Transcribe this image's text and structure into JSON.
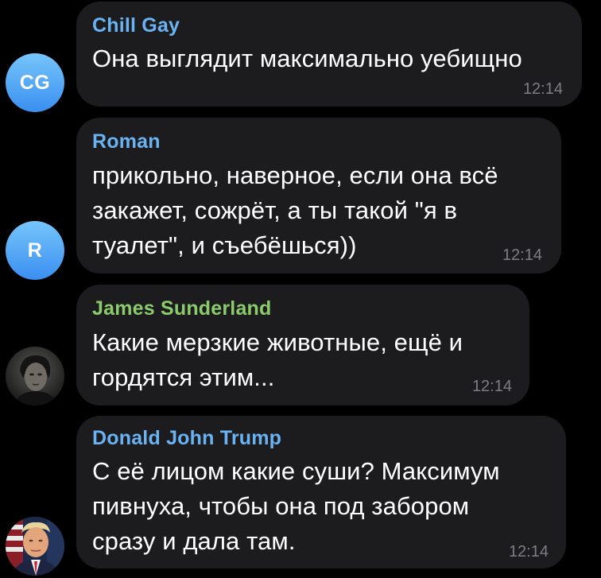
{
  "colors": {
    "background": "#000000",
    "bubble": "#1c1c1e",
    "time_text": "#7d7d84",
    "message_text": "#ffffff",
    "avatar_gradient_top": "#76c5fb",
    "avatar_gradient_bottom": "#3a8ff0"
  },
  "messages": [
    {
      "sender": "Chill Gay",
      "sender_color": "#6ab3f3",
      "text": "Она выглядит максимально уебищно",
      "time": "12:14",
      "avatar": {
        "type": "initials",
        "initials": "CG"
      }
    },
    {
      "sender": "Roman",
      "sender_color": "#6ab3f3",
      "text": "прикольно, наверное, если она всё\nзакажет, сожрёт, а ты такой \"я в\nтуалет\", и съебёшься))",
      "time": "12:14",
      "avatar": {
        "type": "initials",
        "initials": "R"
      }
    },
    {
      "sender": "James Sunderland",
      "sender_color": "#8bcb6a",
      "text": "Какие мерзкие животные, ещё и\nгордятся этим...",
      "time": "12:14",
      "avatar": {
        "type": "photo",
        "icon": "dark-portrait-avatar-icon"
      }
    },
    {
      "sender": "Donald John Trump",
      "sender_color": "#6ab3f3",
      "text": "С её лицом какие суши? Максимум\nпивнуха, чтобы она под забором\nсразу и дала там.",
      "time": "12:14",
      "avatar": {
        "type": "photo",
        "icon": "portrait-with-flag-avatar-icon"
      }
    }
  ]
}
